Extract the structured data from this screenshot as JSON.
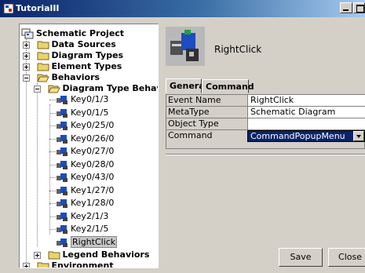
{
  "window": {
    "title": "TutorialII"
  },
  "tree": {
    "root": "Schematic Project",
    "data_sources": "Data Sources",
    "diagram_types": "Diagram Types",
    "element_types": "Element Types",
    "behaviors": "Behaviors",
    "diagram_type_behaviors": "Diagram Type Behaviors",
    "keys": [
      "Key0/1/3",
      "Key0/1/5",
      "Key0/25/0",
      "Key0/26/0",
      "Key0/27/0",
      "Key0/28/0",
      "Key0/43/0",
      "Key1/27/0",
      "Key1/28/0",
      "Key2/1/3",
      "Key2/1/5"
    ],
    "selected": "RightClick",
    "legend_behaviors": "Legend Behaviors",
    "environment": "Environment"
  },
  "detail": {
    "title": "RightClick",
    "tabs": [
      "General",
      "Command"
    ],
    "properties": [
      {
        "name": "Event Name",
        "value": "RightClick"
      },
      {
        "name": "MetaType",
        "value": "Schematic Diagram"
      },
      {
        "name": "Object Type Name",
        "value": ""
      },
      {
        "name": "Command",
        "value": "CommandPopupMenu"
      }
    ]
  },
  "buttons": {
    "save": "Save",
    "close": "Close"
  },
  "icons": {
    "app": "app-icon",
    "folder": "folder-icon",
    "behavior": "behavior-node-icon",
    "detail": "behavior-large-icon"
  },
  "colors": {
    "selection": "#0a246a",
    "folder": "#e8d46a"
  }
}
